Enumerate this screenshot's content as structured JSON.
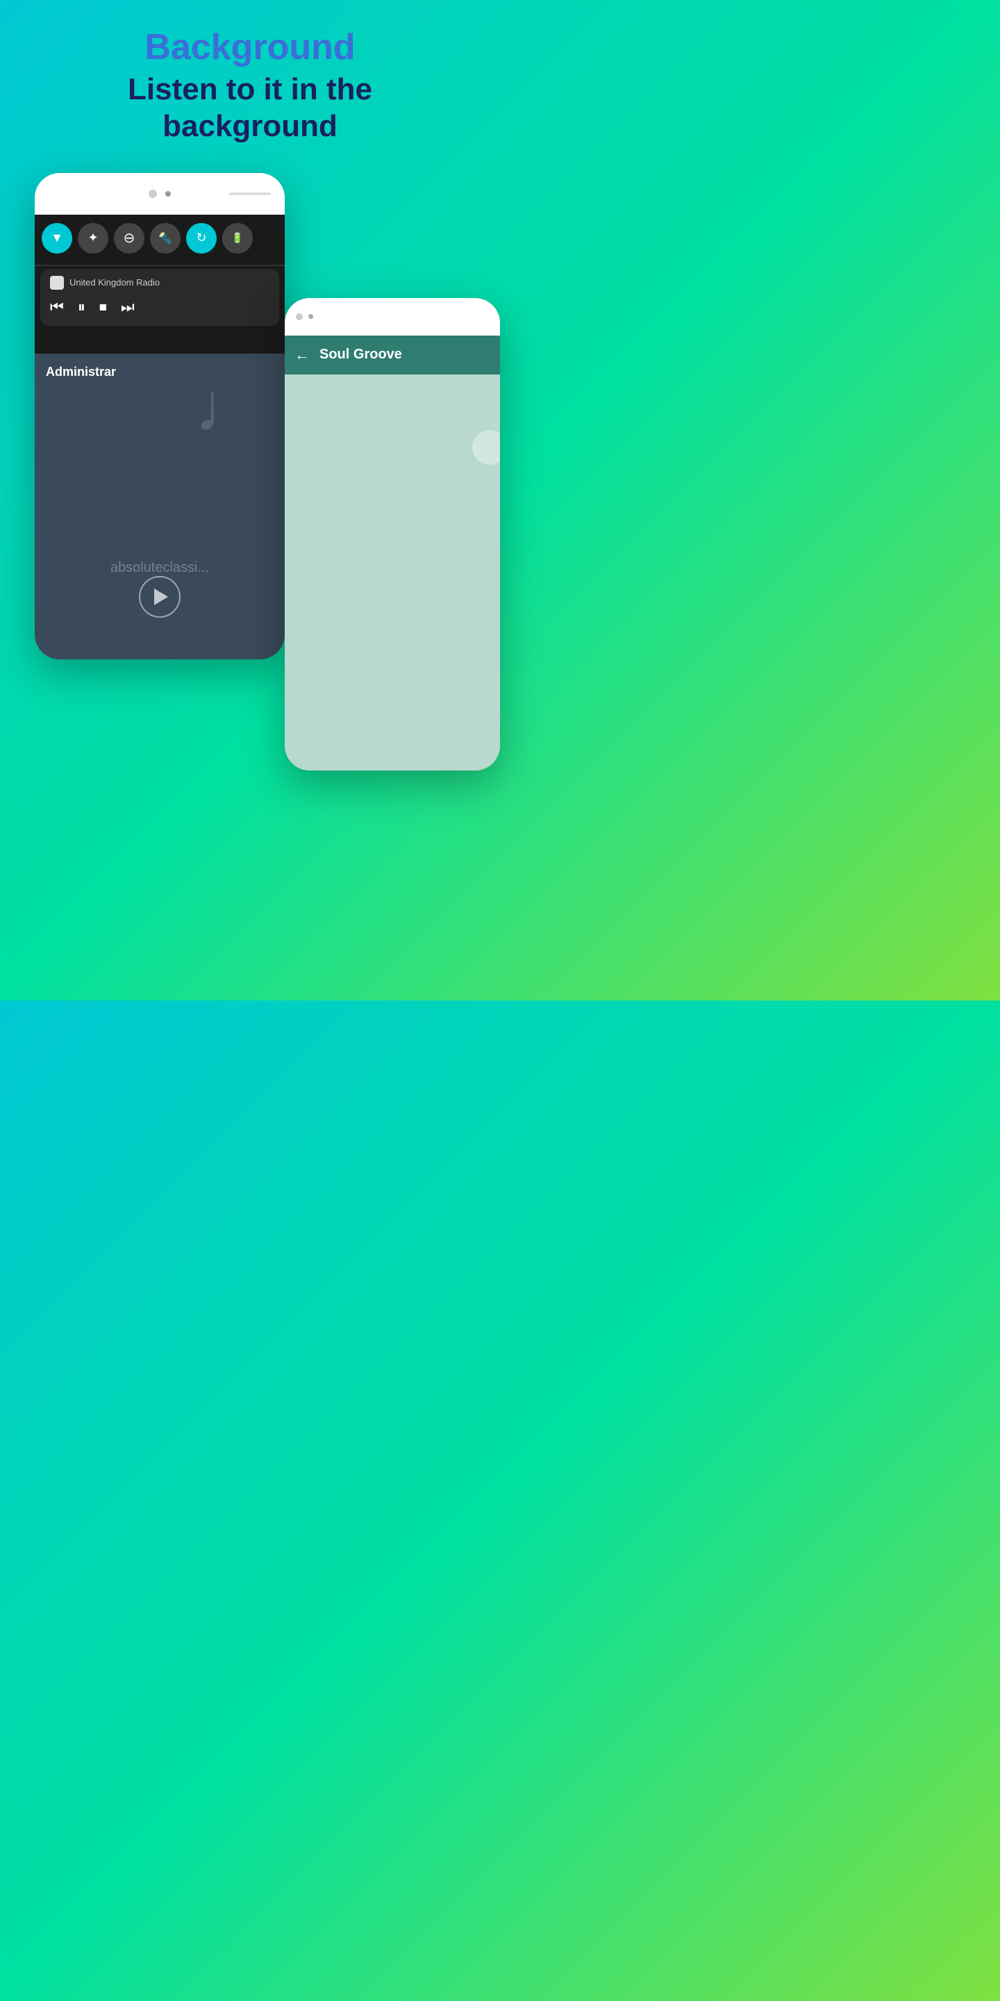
{
  "header": {
    "title": "Background",
    "subtitle": "Listen to it in the background"
  },
  "phone_left": {
    "quick_settings": {
      "icons": [
        {
          "name": "wifi",
          "active": true,
          "symbol": "▼"
        },
        {
          "name": "bluetooth",
          "active": false,
          "symbol": "✦"
        },
        {
          "name": "dnd",
          "active": false,
          "symbol": "⊖"
        },
        {
          "name": "flashlight",
          "active": false,
          "symbol": "⬛"
        },
        {
          "name": "sync",
          "active": true,
          "symbol": "↻"
        },
        {
          "name": "battery",
          "active": false,
          "symbol": "⊡"
        }
      ]
    },
    "notification": {
      "app_name": "United Kingdom Radio",
      "controls": [
        "⏮",
        "⏸",
        "⏹",
        "⏭"
      ]
    },
    "shade": {
      "title": "Administrar",
      "watermark": "absoluteclassi...",
      "music_note": "♩"
    }
  },
  "phone_right": {
    "app_bar": {
      "back_label": "←",
      "title": "Soul Groove"
    },
    "station_bg_color": "#b8d8d0"
  }
}
